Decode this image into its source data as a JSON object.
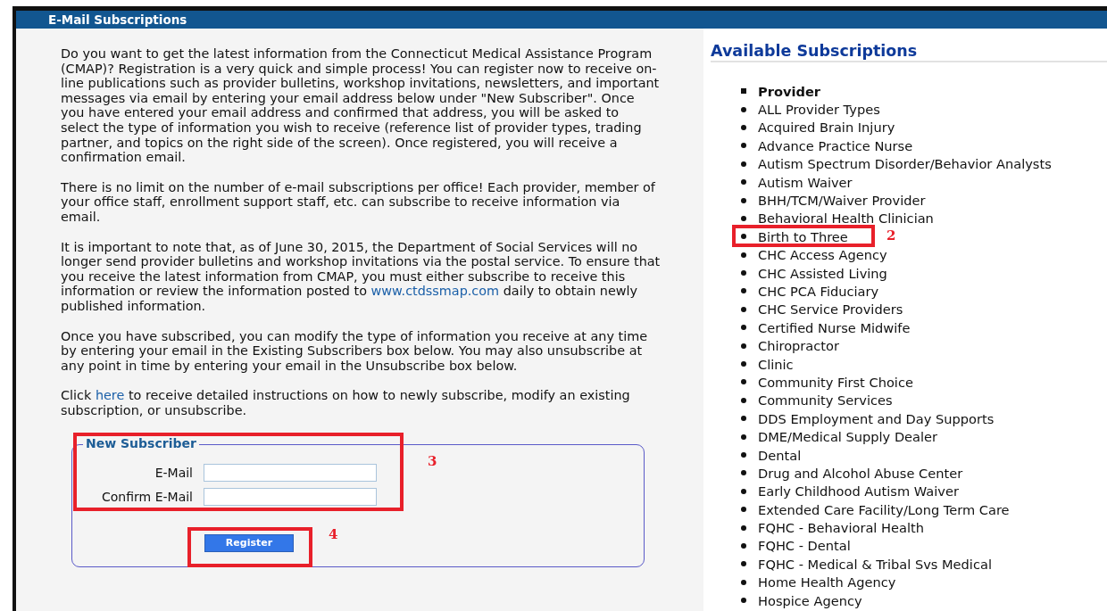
{
  "header": {
    "title": "E-Mail Subscriptions"
  },
  "intro": [
    [
      {
        "kind": "text",
        "text": "Do you want to get the latest information from the Connecticut Medical Assistance Program (CMAP)? Registration is a very quick and simple process! You can register now to receive on-line publications such as provider bulletins, workshop invitations, newsletters, and important messages via email by entering your email address below under \"New Subscriber\". Once you have entered your email address and confirmed that address, you will be asked to select the type of information you wish to receive (reference list of provider types, trading partner, and topics on the right side of the screen). Once registered, you will receive a confirmation email."
      }
    ],
    [
      {
        "kind": "text",
        "text": "There is no limit on the number of e-mail subscriptions per office! Each provider, member of your office staff, enrollment support staff, etc. can subscribe to receive information via email."
      }
    ],
    [
      {
        "kind": "text",
        "text": "It is important to note that, as of June 30, 2015, the Department of Social Services will no longer send provider bulletins and workshop invitations via the postal service. To ensure that you receive the latest information from CMAP, you must either subscribe to receive this information or review the information posted to "
      },
      {
        "kind": "link",
        "text": "www.ctdssmap.com"
      },
      {
        "kind": "text",
        "text": " daily to obtain newly published information."
      }
    ],
    [
      {
        "kind": "text",
        "text": "Once you have subscribed, you can modify the type of information you receive at any time by entering your email in the Existing Subscribers box below. You may also unsubscribe at any point in time by entering your email in the Unsubscribe box below."
      }
    ],
    [
      {
        "kind": "text",
        "text": "Click "
      },
      {
        "kind": "link",
        "text": "here"
      },
      {
        "kind": "text",
        "text": " to receive detailed instructions on how to newly subscribe, modify an existing subscription, or unsubscribe."
      }
    ]
  ],
  "new_subscriber": {
    "legend": "New Subscriber",
    "annotation": "3",
    "fields": [
      {
        "label": "E-Mail"
      },
      {
        "label": "Confirm E-Mail"
      }
    ],
    "button": {
      "label": "Register",
      "annotation": "4"
    }
  },
  "available": {
    "title": "Available Subscriptions",
    "items": [
      {
        "kind": "heading",
        "label": "Provider"
      },
      {
        "kind": "item",
        "label": "ALL Provider Types"
      },
      {
        "kind": "item",
        "label": "Acquired Brain Injury"
      },
      {
        "kind": "item",
        "label": "Advance Practice Nurse"
      },
      {
        "kind": "item",
        "label": "Autism Spectrum Disorder/Behavior Analysts"
      },
      {
        "kind": "item",
        "label": "Autism Waiver"
      },
      {
        "kind": "item",
        "label": "BHH/TCM/Waiver Provider"
      },
      {
        "kind": "item",
        "label": "Behavioral Health Clinician"
      },
      {
        "kind": "item",
        "label": "Birth to Three",
        "annotation": "2"
      },
      {
        "kind": "item",
        "label": "CHC Access Agency"
      },
      {
        "kind": "item",
        "label": "CHC Assisted Living"
      },
      {
        "kind": "item",
        "label": "CHC PCA Fiduciary"
      },
      {
        "kind": "item",
        "label": "CHC Service Providers"
      },
      {
        "kind": "item",
        "label": "Certified Nurse Midwife"
      },
      {
        "kind": "item",
        "label": "Chiropractor"
      },
      {
        "kind": "item",
        "label": "Clinic"
      },
      {
        "kind": "item",
        "label": "Community First Choice"
      },
      {
        "kind": "item",
        "label": "Community Services"
      },
      {
        "kind": "item",
        "label": "DDS Employment and Day Supports"
      },
      {
        "kind": "item",
        "label": "DME/Medical Supply Dealer"
      },
      {
        "kind": "item",
        "label": "Dental"
      },
      {
        "kind": "item",
        "label": "Drug and Alcohol Abuse Center"
      },
      {
        "kind": "item",
        "label": "Early Childhood Autism Waiver"
      },
      {
        "kind": "item",
        "label": "Extended Care Facility/Long Term Care"
      },
      {
        "kind": "item",
        "label": "FQHC - Behavioral Health"
      },
      {
        "kind": "item",
        "label": "FQHC - Dental"
      },
      {
        "kind": "item",
        "label": "FQHC - Medical & Tribal Svs Medical"
      },
      {
        "kind": "item",
        "label": "Home Health Agency"
      },
      {
        "kind": "item",
        "label": "Hospice Agency"
      }
    ]
  }
}
